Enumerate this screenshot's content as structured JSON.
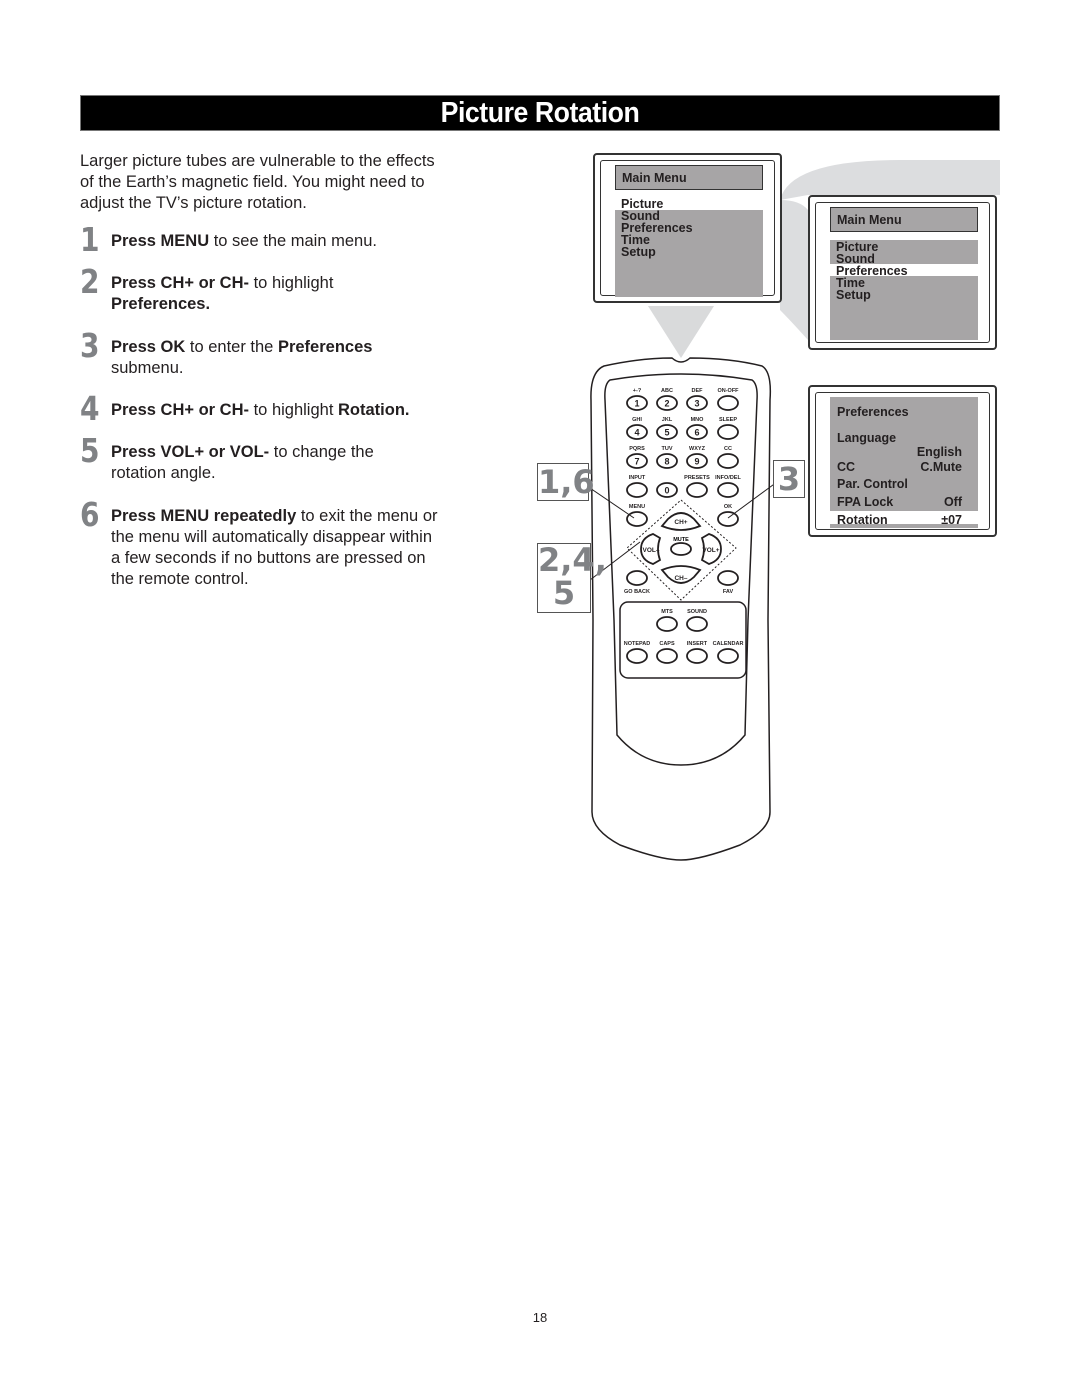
{
  "page": {
    "title": "Picture Rotation",
    "page_number": "18"
  },
  "intro": "Larger picture tubes are vulnerable to the effects of the Earth’s magnetic field. You might need to adjust the TV’s picture rotation.",
  "steps": [
    {
      "number": "1",
      "bold1": "Press MENU",
      "text1": " to see the main menu.",
      "bold2": "",
      "text2": ""
    },
    {
      "number": "2",
      "bold1": "Press CH+ or CH-",
      "text1": " to highlight ",
      "bold2": "Preferences.",
      "text2": ""
    },
    {
      "number": "3",
      "bold1": "Press OK",
      "text1": " to enter the ",
      "bold2": "Preferences",
      "text2": " submenu."
    },
    {
      "number": "4",
      "bold1": "Press CH+ or CH-",
      "text1": " to highlight ",
      "bold2": "Rotation.",
      "text2": ""
    },
    {
      "number": "5",
      "bold1": "Press VOL+ or VOL-",
      "text1": " to change the rotation angle.",
      "bold2": "",
      "text2": ""
    },
    {
      "number": "6",
      "bold1": "Press MENU repeatedly",
      "text1": " to exit the menu or the menu will automatically disappear within a few seconds if no buttons are pressed on the remote control.",
      "bold2": "",
      "text2": ""
    }
  ],
  "screen1": {
    "header": "Main Menu",
    "items": [
      "Picture",
      "Sound",
      "Preferences",
      "Time",
      "Setup"
    ],
    "highlighted": "Picture"
  },
  "screen2": {
    "header": "Main Menu",
    "items": [
      "Picture",
      "Sound",
      "Preferences",
      "Time",
      "Setup"
    ],
    "highlighted": "Preferences"
  },
  "screen3": {
    "header": "Preferences",
    "rows": [
      {
        "label": "Language",
        "value": "English"
      },
      {
        "label": "CC",
        "value": "C.Mute"
      },
      {
        "label": "Par. Control",
        "value": ""
      },
      {
        "label": "FPA Lock",
        "value": "Off"
      },
      {
        "label": "Rotation",
        "value": "±07"
      }
    ],
    "highlighted": "Rotation"
  },
  "callouts": {
    "left_top": "1,6",
    "left_bottom_line1": "2,4,",
    "left_bottom_line2": "5",
    "right": "3"
  },
  "remote": {
    "keypad": [
      {
        "label": "+-?",
        "key": "1"
      },
      {
        "label": "ABC",
        "key": "2"
      },
      {
        "label": "DEF",
        "key": "3"
      },
      {
        "label": "ON-OFF",
        "key": ""
      },
      {
        "label": "GHI",
        "key": "4"
      },
      {
        "label": "JKL",
        "key": "5"
      },
      {
        "label": "MNO",
        "key": "6"
      },
      {
        "label": "SLEEP",
        "key": ""
      },
      {
        "label": "PQRS",
        "key": "7"
      },
      {
        "label": "TUV",
        "key": "8"
      },
      {
        "label": "WXYZ",
        "key": "9"
      },
      {
        "label": "CC",
        "key": ""
      },
      {
        "label": "INPUT",
        "key": ""
      },
      {
        "label": "",
        "key": "0"
      },
      {
        "label": "PRESETS",
        "key": ""
      },
      {
        "label": "INFO/DEL",
        "key": ""
      }
    ],
    "menu": "MENU",
    "ok": "OK",
    "ch_up": "CH+",
    "ch_down": "CH–",
    "vol_down": "VOL–",
    "vol_up": "VOL+",
    "mute": "MUTE",
    "go_back": "GO BACK",
    "fav": "FAV",
    "mts": "MTS",
    "sound": "SOUND",
    "notepad": "NOTEPAD",
    "caps": "CAPS",
    "insert": "INSERT",
    "calendar": "CALENDAR"
  }
}
